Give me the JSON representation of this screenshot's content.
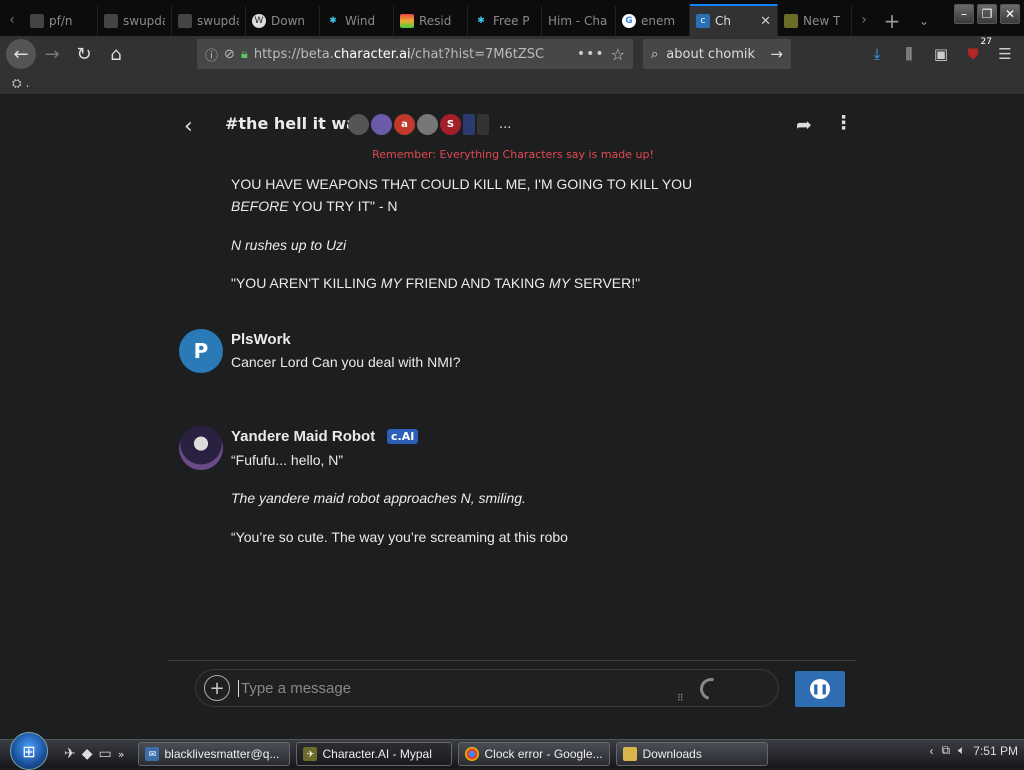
{
  "browser": {
    "tabs": [
      {
        "title": "pf/n",
        "favicon": "page-icon"
      },
      {
        "title": "swupdate",
        "favicon": "page-icon"
      },
      {
        "title": "swupdate",
        "favicon": "page-icon"
      },
      {
        "title": "Down",
        "favicon": "wordpress-icon"
      },
      {
        "title": "Wind",
        "favicon": "snowflake-icon"
      },
      {
        "title": "Resid",
        "favicon": "rainbow-icon"
      },
      {
        "title": "Free P",
        "favicon": "snowflake-icon"
      },
      {
        "title": "Him - Cha",
        "favicon": "page-icon"
      },
      {
        "title": "enem",
        "favicon": "google-icon"
      },
      {
        "title": "Ch",
        "favicon": "characterai-icon"
      },
      {
        "title": "New T",
        "favicon": "firefox-icon"
      }
    ],
    "url_prefix": "https://beta.",
    "url_domain": "character.ai",
    "url_suffix": "/chat?hist=7M6tZSC",
    "search_text": "about chomik",
    "ublock_count": "27",
    "bookmark_label": "."
  },
  "chat": {
    "title": "#the hell it was",
    "more_avatars": "...",
    "disclaimer": "Remember: Everything Characters say is made up!",
    "prev_message": {
      "line1": "YOU HAVE WEAPONS THAT COULD KILL ME, I'M GOING TO KILL YOU",
      "line2_italic": "BEFORE",
      "line2_rest": " YOU TRY IT\" - N",
      "line3": "N rushes up to Uzi",
      "line4_a": "\"YOU AREN'T KILLING ",
      "line4_b": "MY",
      "line4_c": " FRIEND AND TAKING ",
      "line4_d": "MY",
      "line4_e": " SERVER!\""
    },
    "user_message": {
      "avatar_letter": "P",
      "avatar_color": "#2a7ab8",
      "name": "PlsWork",
      "text": "Cancer Lord Can you deal with NMI?"
    },
    "bot_message": {
      "name": "Yandere Maid Robot",
      "badge": "c.AI",
      "line1": "“Fufufu... hello, N”",
      "line2": "The yandere maid robot approaches N, smiling.",
      "line3": "“You’re so cute. The way you’re screaming at this robo"
    },
    "avatars": [
      {
        "label": "",
        "color": "#555"
      },
      {
        "label": "",
        "color": "#6b5aa8"
      },
      {
        "label": "a",
        "color": "#c0392b"
      },
      {
        "label": "",
        "color": "#777"
      },
      {
        "label": "S",
        "color": "#a31f2a"
      },
      {
        "label": "",
        "color": "#2c3a70"
      },
      {
        "label": "",
        "color": "#333"
      }
    ],
    "input_placeholder": "Type a message"
  },
  "taskbar": {
    "tasks": [
      {
        "label": "blacklivesmatter@q...",
        "icon": "mail-icon"
      },
      {
        "label": "Character.AI - Mypal",
        "icon": "mypal-icon"
      },
      {
        "label": "Clock error - Google...",
        "icon": "chrome-icon"
      },
      {
        "label": "Downloads",
        "icon": "folder-icon"
      }
    ],
    "time": "7:51 PM"
  }
}
